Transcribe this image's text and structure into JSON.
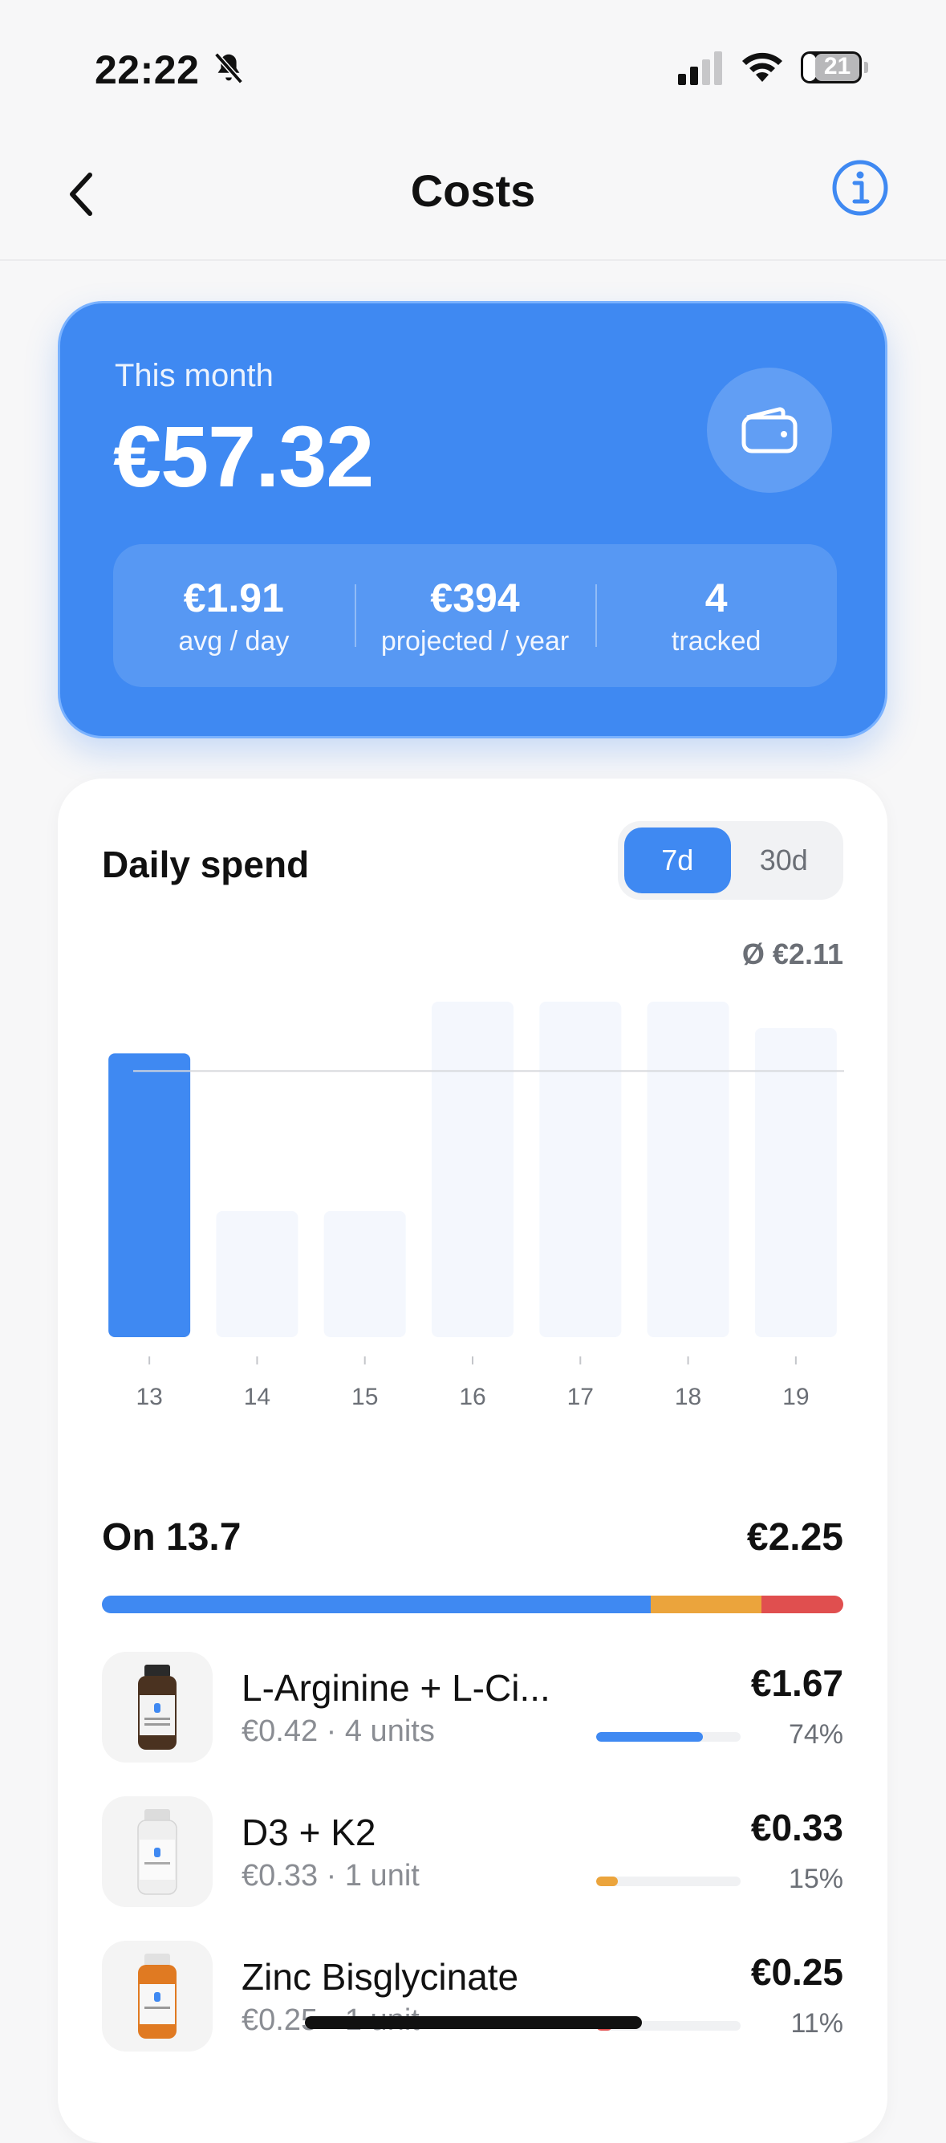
{
  "status_bar": {
    "time": "22:22",
    "battery": "21"
  },
  "nav": {
    "title": "Costs"
  },
  "hero": {
    "label": "This month",
    "amount": "€57.32",
    "stats": [
      {
        "value": "€1.91",
        "label": "avg / day"
      },
      {
        "value": "€394",
        "label": "projected / year"
      },
      {
        "value": "4",
        "label": "tracked"
      }
    ]
  },
  "spend": {
    "title": "Daily spend",
    "tabs": [
      "7d",
      "30d"
    ],
    "active_tab": "7d",
    "average_label": "Ø €2.11"
  },
  "chart_data": {
    "type": "bar",
    "categories": [
      "13",
      "14",
      "15",
      "16",
      "17",
      "18",
      "19"
    ],
    "values": [
      2.25,
      1.0,
      1.0,
      2.66,
      2.66,
      2.66,
      2.45
    ],
    "average": 2.11,
    "selected_index": 0,
    "colors": {
      "selected": "#3f89f2",
      "unselected": "#f4f7fd",
      "average_line": "#d6d8dc"
    }
  },
  "day": {
    "title": "On 13.7",
    "total": "€2.25",
    "segments": [
      {
        "fraction": 0.74,
        "color": "#3f89f2"
      },
      {
        "fraction": 0.15,
        "color": "#eba43c"
      },
      {
        "fraction": 0.11,
        "color": "#e04f4f"
      }
    ],
    "items": [
      {
        "name": "L-Arginine + L-Ci...",
        "sub": "€0.42 · 4 units",
        "amount": "€1.67",
        "pct": "74%",
        "fraction": 0.74,
        "color": "#3f89f2",
        "icon": "bottle-dark-icon"
      },
      {
        "name": "D3 + K2",
        "sub": "€0.33 · 1 unit",
        "amount": "€0.33",
        "pct": "15%",
        "fraction": 0.15,
        "color": "#eba43c",
        "icon": "bottle-white-icon"
      },
      {
        "name": "Zinc Bisglycinate",
        "sub": "€0.25 · 1 unit",
        "amount": "€0.25",
        "pct": "11%",
        "fraction": 0.11,
        "color": "#e04f4f",
        "icon": "bottle-orange-icon"
      }
    ]
  }
}
